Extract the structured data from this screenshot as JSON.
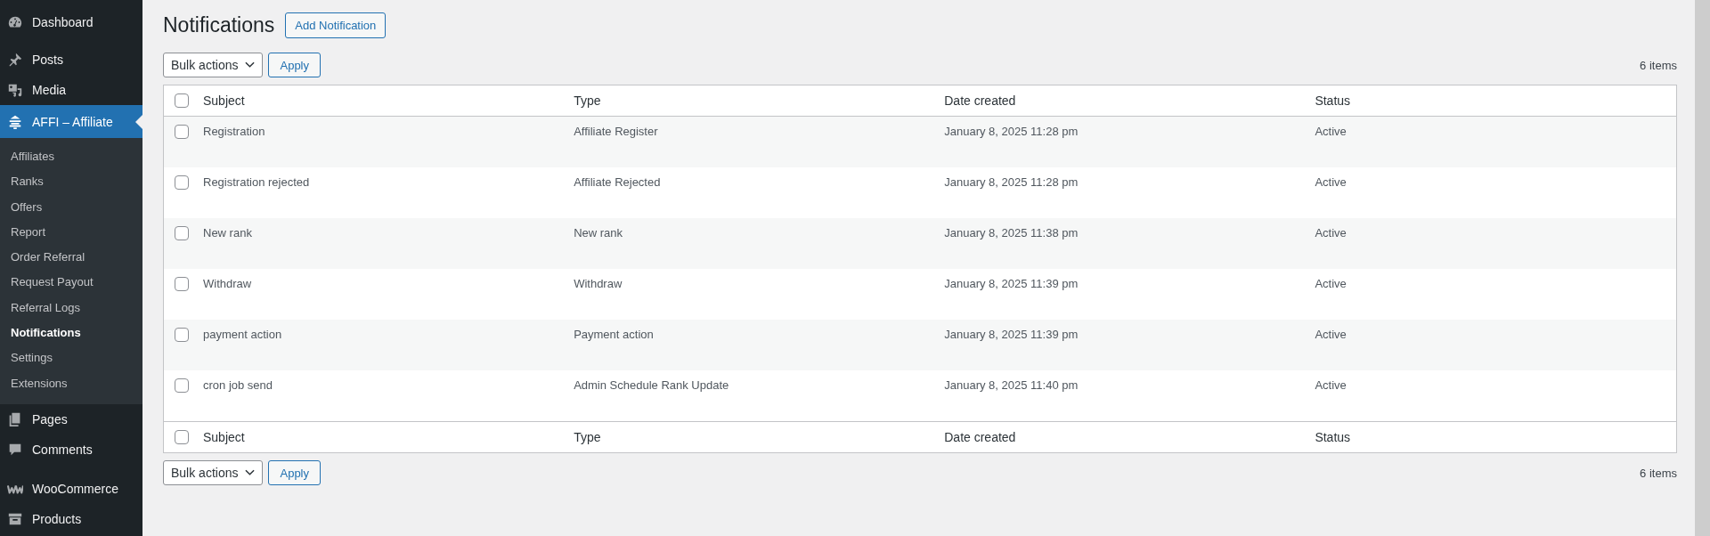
{
  "sidebar": {
    "items": [
      {
        "label": "Dashboard",
        "selected": false
      },
      {
        "label": "Posts",
        "selected": false
      },
      {
        "label": "Media",
        "selected": false
      },
      {
        "label": "AFFI – Affiliate",
        "selected": true,
        "children": [
          {
            "label": "Affiliates",
            "selected": false
          },
          {
            "label": "Ranks",
            "selected": false
          },
          {
            "label": "Offers",
            "selected": false
          },
          {
            "label": "Report",
            "selected": false
          },
          {
            "label": "Order Referral",
            "selected": false
          },
          {
            "label": "Request Payout",
            "selected": false
          },
          {
            "label": "Referral Logs",
            "selected": false
          },
          {
            "label": "Notifications",
            "selected": true
          },
          {
            "label": "Settings",
            "selected": false
          },
          {
            "label": "Extensions",
            "selected": false
          }
        ]
      },
      {
        "label": "Pages",
        "selected": false
      },
      {
        "label": "Comments",
        "selected": false
      },
      {
        "label": "WooCommerce",
        "selected": false
      },
      {
        "label": "Products",
        "selected": false
      }
    ]
  },
  "page": {
    "title": "Notifications",
    "add_button": "Add Notification"
  },
  "top_toolbar": {
    "bulk_actions": "Bulk actions",
    "apply": "Apply",
    "count": "6 items"
  },
  "table": {
    "select_all_checked": false,
    "columns": [
      "Subject",
      "Type",
      "Date created",
      "Status"
    ],
    "rows": [
      {
        "checked": false,
        "cells": [
          "Registration",
          "Affiliate Register",
          "January 8, 2025 11:28 pm",
          "Active"
        ]
      },
      {
        "checked": false,
        "cells": [
          "Registration rejected",
          "Affiliate Rejected",
          "January 8, 2025 11:28 pm",
          "Active"
        ]
      },
      {
        "checked": false,
        "cells": [
          "New rank",
          "New rank",
          "January 8, 2025 11:38 pm",
          "Active"
        ]
      },
      {
        "checked": false,
        "cells": [
          "Withdraw",
          "Withdraw",
          "January 8, 2025 11:39 pm",
          "Active"
        ]
      },
      {
        "checked": false,
        "cells": [
          "payment action",
          "Payment action",
          "January 8, 2025 11:39 pm",
          "Active"
        ]
      },
      {
        "checked": false,
        "cells": [
          "cron job send",
          "Admin Schedule Rank Update",
          "January 8, 2025 11:40 pm",
          "Active"
        ]
      }
    ],
    "footer_columns": [
      "Subject",
      "Type",
      "Date created",
      "Status"
    ],
    "footer_select_all_checked": false
  },
  "bottom_toolbar": {
    "bulk_actions": "Bulk actions",
    "apply": "Apply",
    "count": "6 items"
  }
}
